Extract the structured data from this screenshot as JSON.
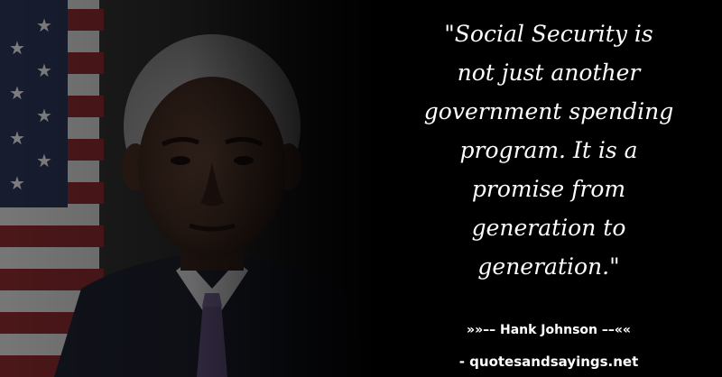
{
  "quote": {
    "lines": [
      "\"Social Security is",
      "not just another",
      "government spending",
      "program. It is a",
      "promise from",
      "generation to",
      "generation.\""
    ]
  },
  "attribution": "»»–– Hank Johnson ––««",
  "source": "- quotesandsayings.net",
  "colors": {
    "background": "#000000",
    "text": "#ffffff",
    "flag_red": "#8a2a2e",
    "flag_blue": "#2a3556"
  },
  "image": {
    "subject": "portrait-photo",
    "icons": [
      "us-flag"
    ]
  }
}
